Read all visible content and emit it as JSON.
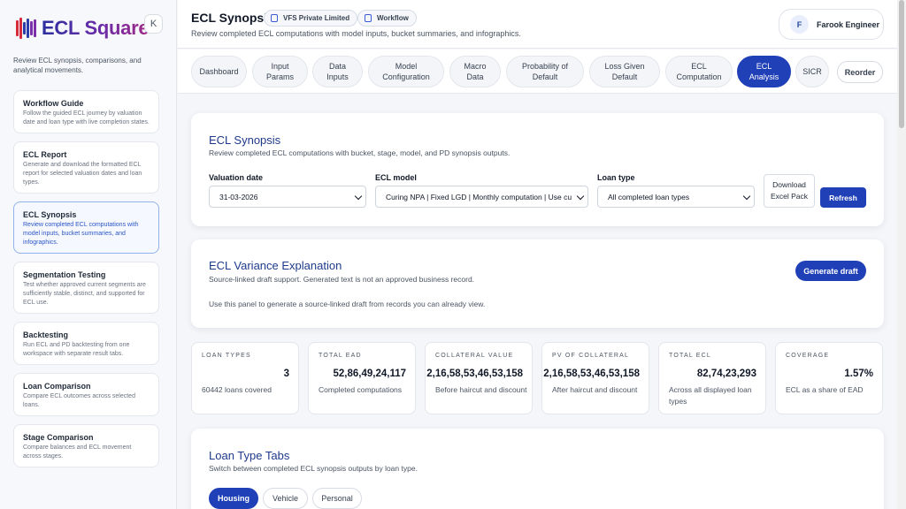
{
  "brand": {
    "name": "ECL Square",
    "collapse_label": "K",
    "colors": [
      "#d62b3a",
      "#2c3ea8",
      "#7b2fa8"
    ]
  },
  "sidebar": {
    "description": "Review ECL synopsis, comparisons, and analytical movements.",
    "items": [
      {
        "title": "Workflow Guide",
        "desc": "Follow the guided ECL journey by valuation date and loan type with live completion states."
      },
      {
        "title": "ECL Report",
        "desc": "Generate and download the formatted ECL report for selected valuation dates and loan types."
      },
      {
        "title": "ECL Synopsis",
        "desc": "Review completed ECL computations with model inputs, bucket summaries, and infographics."
      },
      {
        "title": "Segmentation Testing",
        "desc": "Test whether approved current segments are sufficiently stable, distinct, and supported for ECL use."
      },
      {
        "title": "Backtesting",
        "desc": "Run ECL and PD backtesting from one workspace with separate result tabs."
      },
      {
        "title": "Loan Comparison",
        "desc": "Compare ECL outcomes across selected loans."
      },
      {
        "title": "Stage Comparison",
        "desc": "Compare balances and ECL movement across stages."
      }
    ]
  },
  "header": {
    "title": "ECL Synopsis",
    "badge_org": "VFS Private Limited",
    "badge_workflow": "Workflow",
    "subtitle": "Review completed ECL computations with model inputs, bucket summaries, and infographics.",
    "user_initial": "F",
    "user_name": "Farook Engineer"
  },
  "tabs": {
    "t0": "Dashboard",
    "t1": "Input Params",
    "t2": "Data Inputs",
    "t3": "Model Configuration",
    "t4": "Macro Data",
    "t5": "Probability of Default",
    "t6": "Loss Given Default",
    "t7": "ECL Computation",
    "t8": "ECL Analysis",
    "t9": "SICR",
    "reorder": "Reorder"
  },
  "synopsis": {
    "title": "ECL Synopsis",
    "subtitle": "Review completed ECL computations with bucket, stage, model, and PD synopsis outputs.",
    "valuation_label": "Valuation date",
    "valuation_value": "31-03-2026",
    "model_label": "ECL model",
    "model_value": "Curing NPA | Fixed LGD | Monthly computation | Use cu",
    "loan_label": "Loan type",
    "loan_value": "All completed loan types",
    "download_label": "Download Excel Pack",
    "refresh_label": "Refresh"
  },
  "variance": {
    "title": "ECL Variance Explanation",
    "subtitle": "Source-linked draft support. Generated text is not an approved business record.",
    "note": "Use this panel to generate a source-linked draft from records you can already view.",
    "button": "Generate draft"
  },
  "stats": [
    {
      "label": "LOAN TYPES",
      "value": "3",
      "note": "60442 loans covered"
    },
    {
      "label": "TOTAL EAD",
      "value": "52,86,49,24,117",
      "note": "Completed computations"
    },
    {
      "label": "COLLATERAL VALUE",
      "value": "2,16,58,53,46,53,158",
      "note": "Before haircut and discount"
    },
    {
      "label": "PV OF COLLATERAL",
      "value": "2,16,58,53,46,53,158",
      "note": "After haircut and discount"
    },
    {
      "label": "TOTAL ECL",
      "value": "82,74,23,293",
      "note": "Across all displayed loan types"
    },
    {
      "label": "COVERAGE",
      "value": "1.57%",
      "note": "ECL as a share of EAD"
    }
  ],
  "loan_tabs": {
    "title": "Loan Type Tabs",
    "subtitle": "Switch between completed ECL synopsis outputs by loan type.",
    "tab0": "Housing",
    "tab1": "Vehicle",
    "tab2": "Personal"
  }
}
